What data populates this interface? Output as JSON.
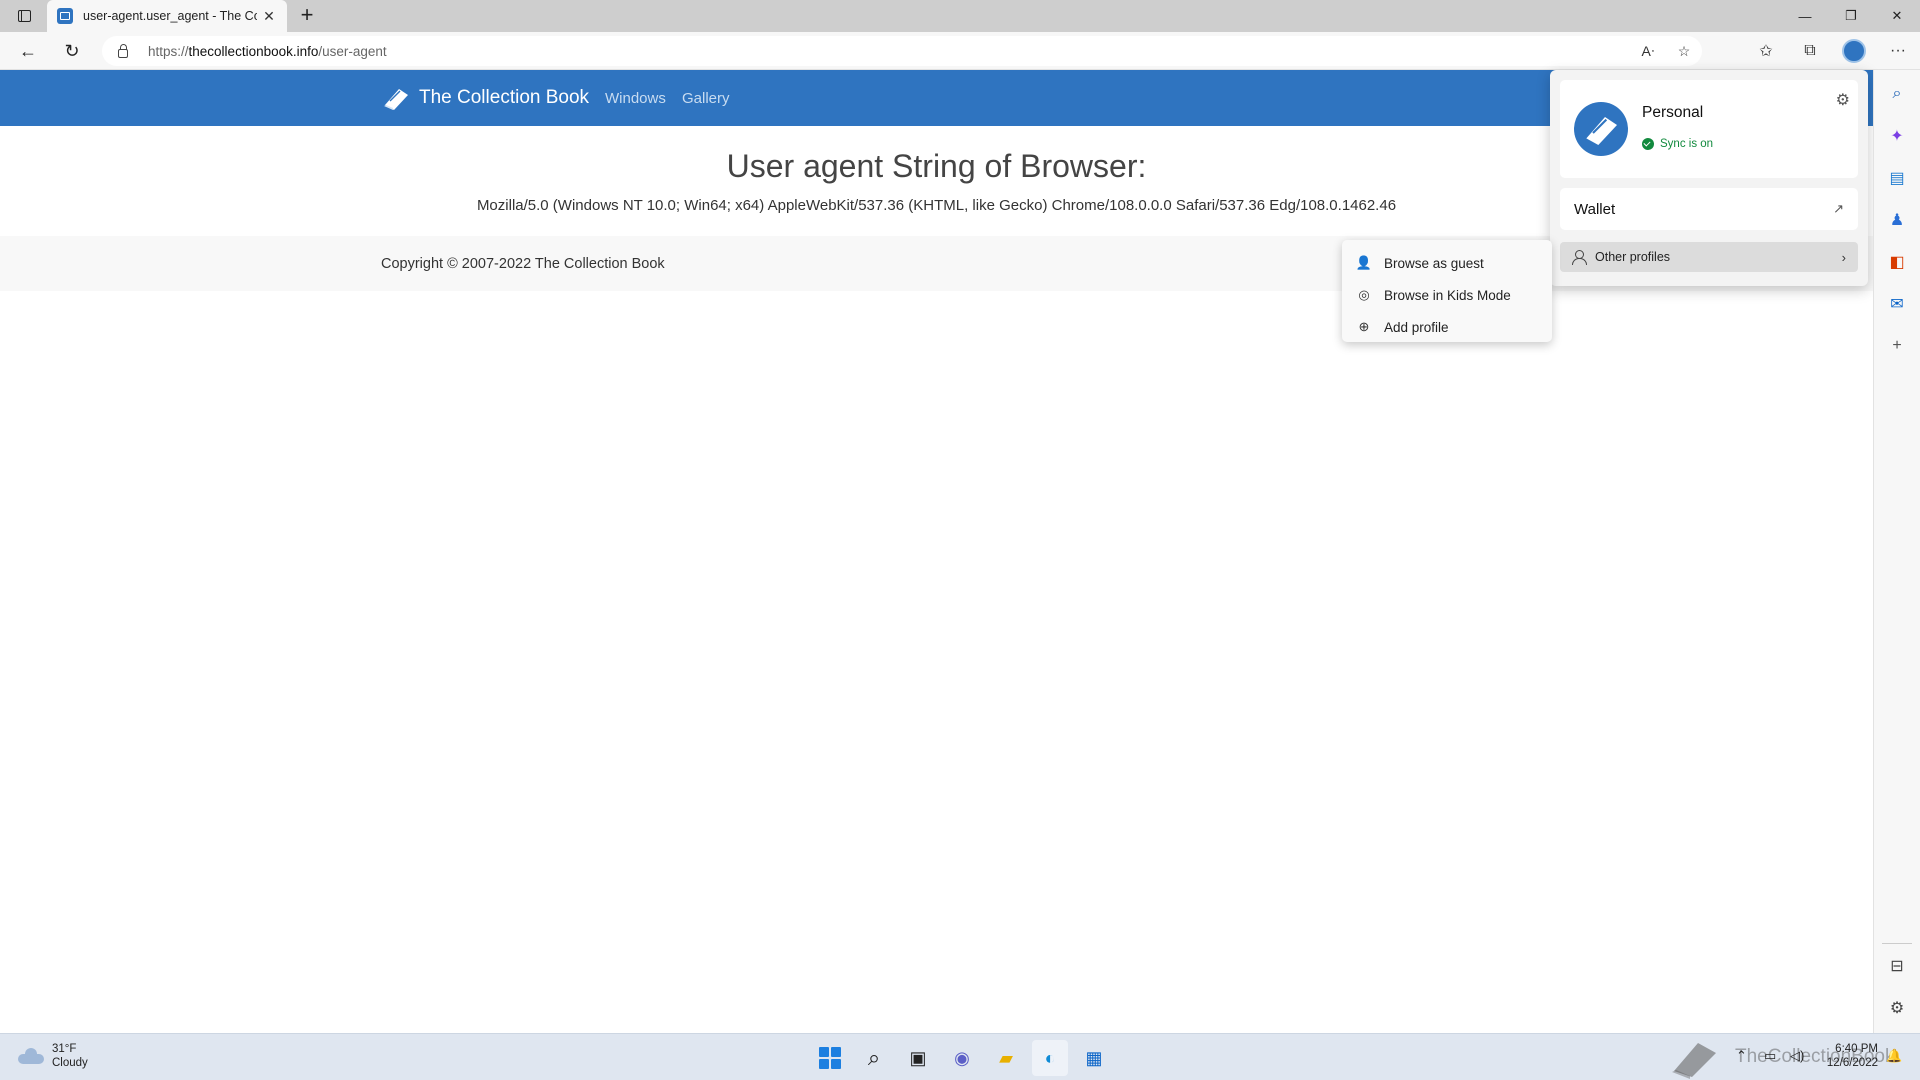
{
  "browser": {
    "tab_title": "user-agent.user_agent - The Coll",
    "url_prefix": "https://",
    "url_domain": "thecollectionbook.info",
    "url_path": "/user-agent",
    "window_controls": {
      "minimize": "—",
      "restore": "❐",
      "close": "✕"
    }
  },
  "site": {
    "brand": "The Collection Book",
    "nav": [
      "Windows",
      "Gallery"
    ],
    "heading": "User agent String of Browser:",
    "user_agent": "Mozilla/5.0 (Windows NT 10.0; Win64; x64) AppleWebKit/537.36 (KHTML, like Gecko) Chrome/108.0.0.0 Safari/537.36 Edg/108.0.1462.46",
    "copyright": "Copyright © 2007-2022 The Collection Book"
  },
  "profile_panel": {
    "name": "Personal",
    "sync_status": "Sync is on",
    "wallet": "Wallet",
    "other_profiles": "Other profiles"
  },
  "submenu": {
    "items": [
      {
        "label": "Browse as guest",
        "icon": "guest-icon"
      },
      {
        "label": "Browse in Kids Mode",
        "icon": "kids-mode-icon"
      },
      {
        "label": "Add profile",
        "icon": "add-circle-icon"
      }
    ]
  },
  "taskbar": {
    "temperature": "31°F",
    "condition": "Cloudy",
    "time": "6:40 PM",
    "date": "12/6/2022",
    "watermark": "TheCollectionBook"
  },
  "colors": {
    "site_blue": "#2f74c0",
    "sync_green": "#128a3e"
  }
}
